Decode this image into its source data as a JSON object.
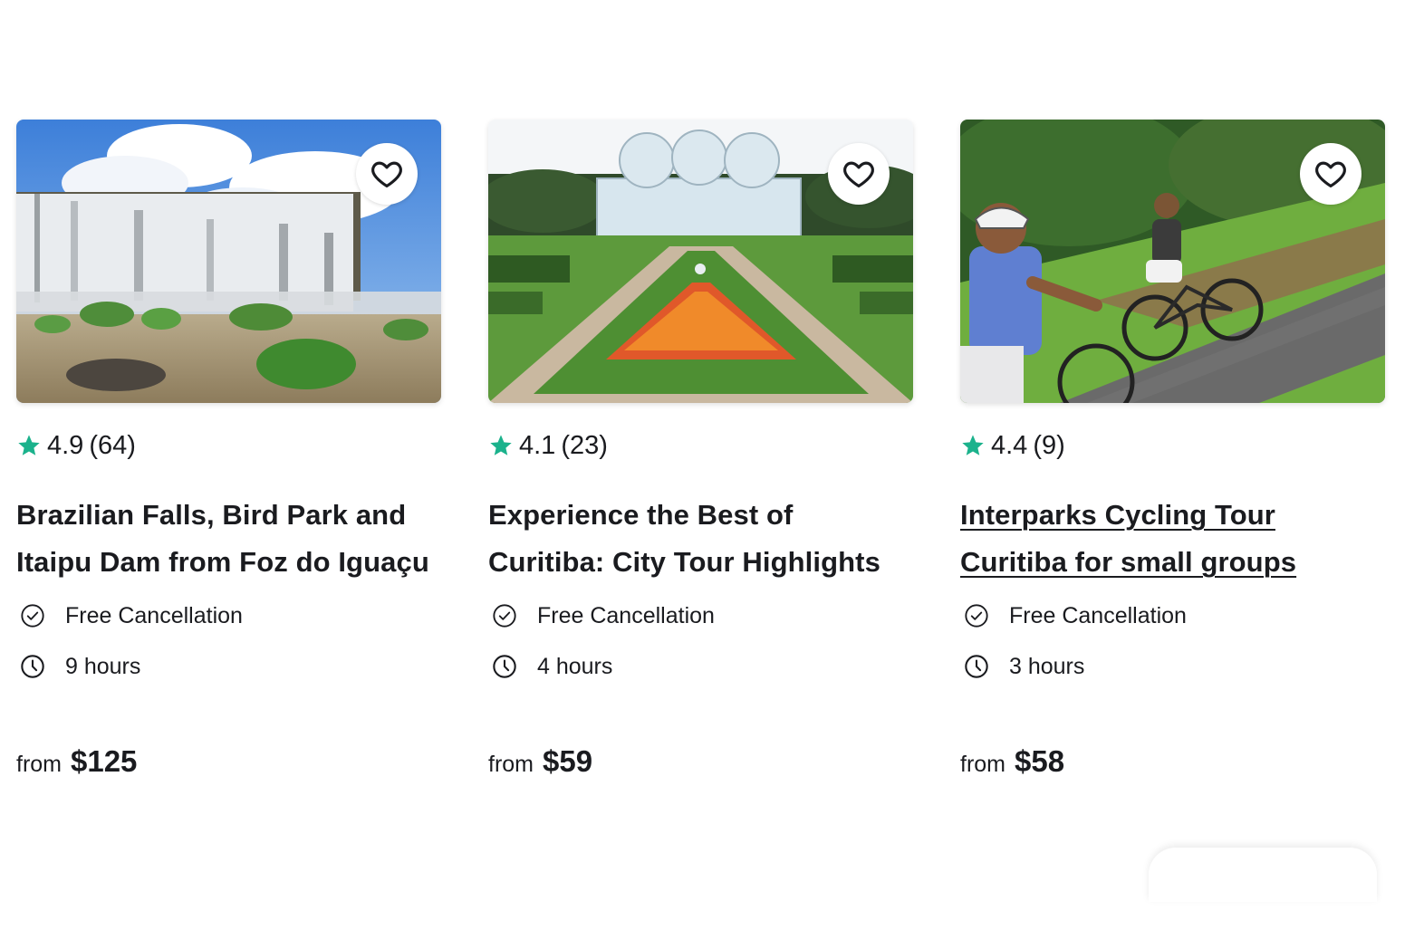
{
  "cards": [
    {
      "image_alt": "Iguaçu Falls waterfall",
      "rating": "4.9",
      "reviews": "(64)",
      "title": "Brazilian Falls, Bird Park and Itaipu Dam from Foz do Iguaçu",
      "features": [
        "Free Cancellation",
        "9 hours"
      ],
      "price_from": "from",
      "price": "$125"
    },
    {
      "image_alt": "Curitiba Botanical Garden greenhouse",
      "rating": "4.1",
      "reviews": "(23)",
      "title": "Experience the Best of Curitiba: City Tour Highlights",
      "features": [
        "Free Cancellation",
        "4 hours"
      ],
      "price_from": "from",
      "price": "$59"
    },
    {
      "image_alt": "Cyclists riding through a park",
      "rating": "4.4",
      "reviews": "(9)",
      "title": "Interparks Cycling Tour Curitiba for small groups",
      "features": [
        "Free Cancellation",
        "3 hours"
      ],
      "price_from": "from",
      "price": "$58"
    }
  ],
  "icons": {
    "favorite": "heart-outline-icon",
    "rating": "star-icon",
    "cancellation": "check-circle-icon",
    "duration": "clock-icon"
  },
  "colors": {
    "star": "#1bb28c",
    "text": "#1a1b1f",
    "background": "#ffffff"
  }
}
